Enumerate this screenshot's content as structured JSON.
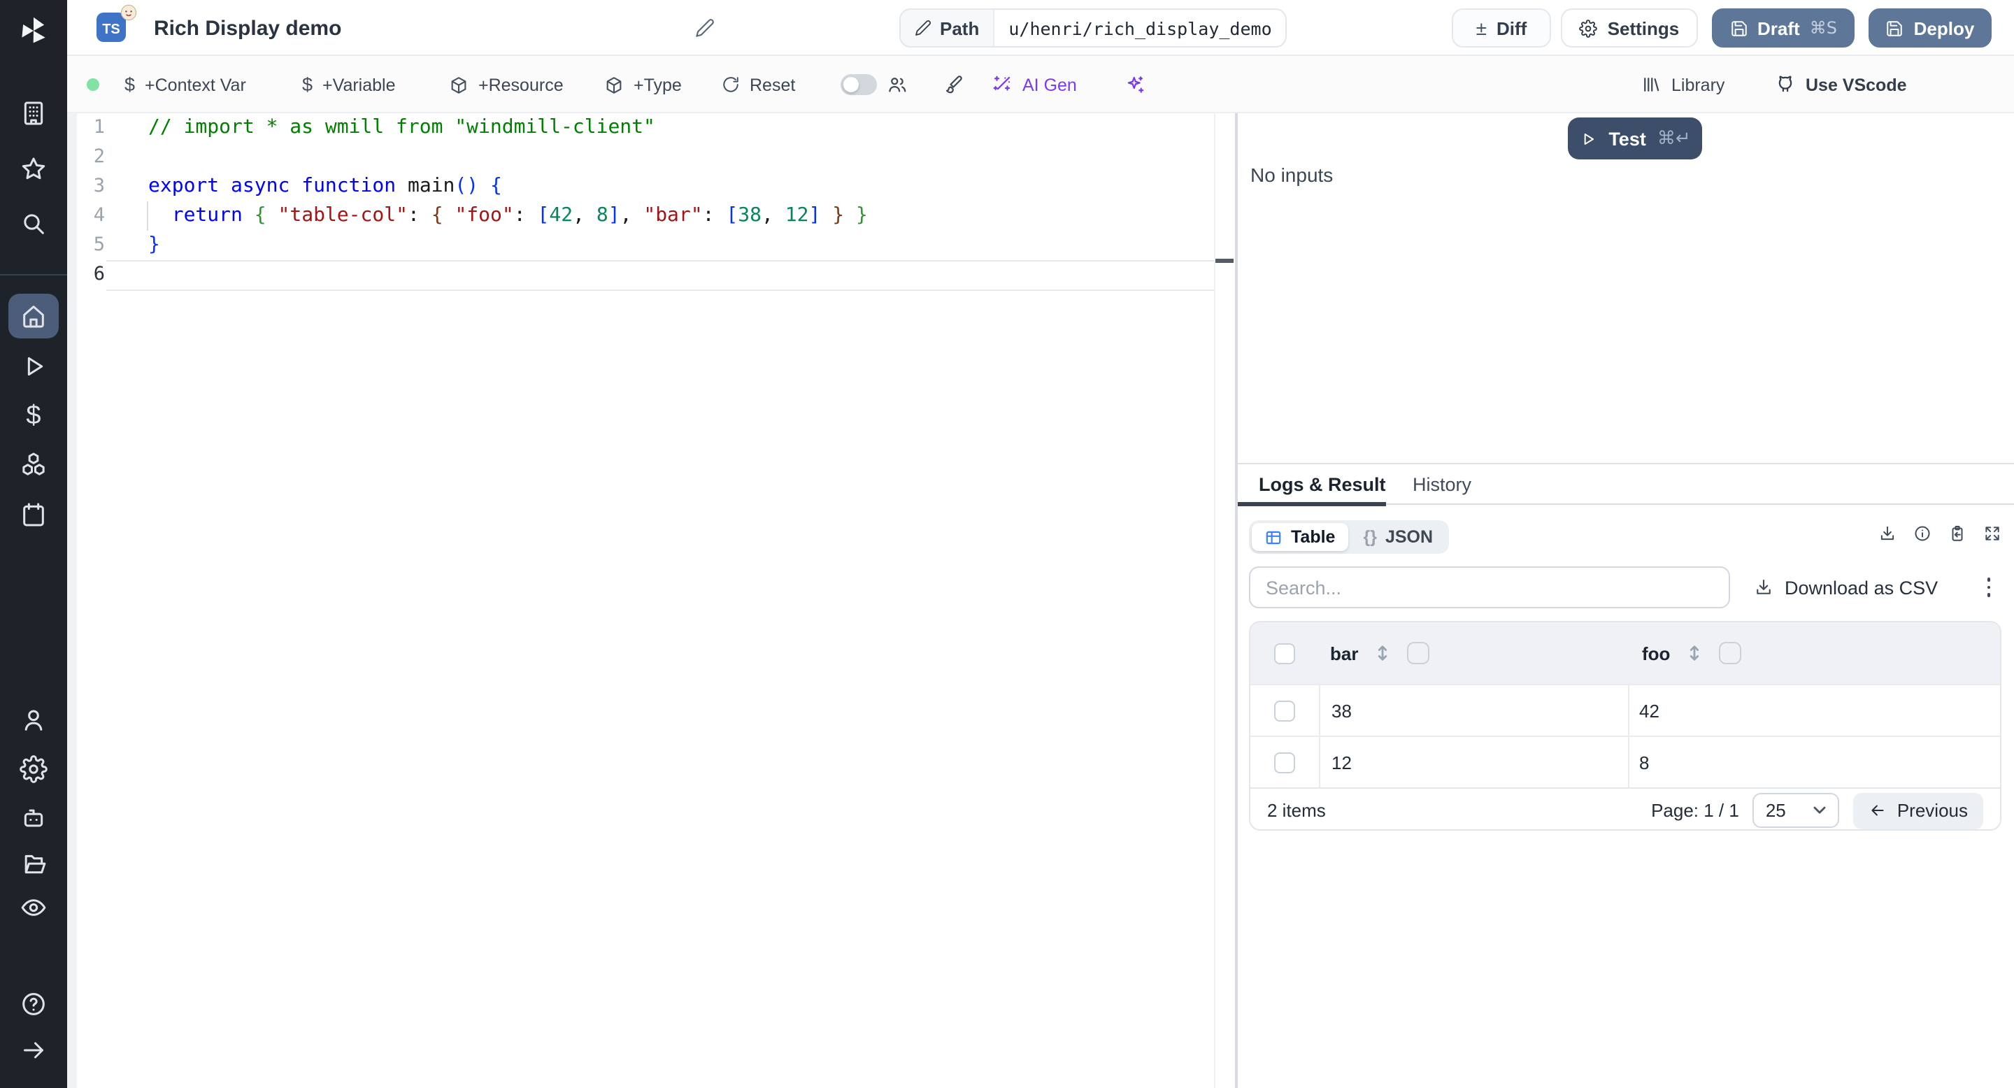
{
  "colors": {
    "accent-button": "#5e7798",
    "test-button": "#3d4e6b",
    "ai-purple": "#7c3aed",
    "ts-blue": "#3f73c6",
    "table-icon-blue": "#3b82f6",
    "status-green": "#80e3a3",
    "sidebar-bg": "#1e232a",
    "sidebar-active": "#4b5d79"
  },
  "topbar": {
    "language_badge": "TS",
    "title": "Rich Display demo",
    "path_label": "Path",
    "path_value": "u/henri/rich_display_demo",
    "diff_label": "Diff",
    "diff_icon": "±",
    "settings_label": "Settings",
    "draft_label": "Draft",
    "draft_shortcut": "⌘S",
    "deploy_label": "Deploy"
  },
  "toolbar": {
    "dollar_icon": "$",
    "context_var_label": "+Context Var",
    "variable_label": "+Variable",
    "resource_label": "+Resource",
    "type_label": "+Type",
    "reset_label": "Reset",
    "ai_gen_label": "AI Gen",
    "library_label": "Library",
    "vscode_label": "Use VScode"
  },
  "editor": {
    "lines": [
      {
        "number": "1",
        "tokens": [
          [
            "// import * as wmill from \"windmill-client\"",
            "comment"
          ]
        ]
      },
      {
        "number": "2",
        "tokens": []
      },
      {
        "number": "3",
        "tokens": [
          [
            "export",
            "keyword"
          ],
          [
            " ",
            "plain"
          ],
          [
            "async",
            "keyword"
          ],
          [
            " ",
            "plain"
          ],
          [
            "function",
            "keyword"
          ],
          [
            " ",
            "plain"
          ],
          [
            "main",
            "plain"
          ],
          [
            "()",
            "b1"
          ],
          [
            " ",
            "plain"
          ],
          [
            "{",
            "b1"
          ]
        ]
      },
      {
        "number": "4",
        "tokens": [
          [
            "  ",
            "plain"
          ],
          [
            "return",
            "keyword"
          ],
          [
            " ",
            "plain"
          ],
          [
            "{",
            "b2"
          ],
          [
            " ",
            "plain"
          ],
          [
            "\"table-col\"",
            "string"
          ],
          [
            ":",
            "plain"
          ],
          [
            " ",
            "plain"
          ],
          [
            "{",
            "b3"
          ],
          [
            " ",
            "plain"
          ],
          [
            "\"foo\"",
            "string"
          ],
          [
            ":",
            "plain"
          ],
          [
            " ",
            "plain"
          ],
          [
            "[",
            "b1"
          ],
          [
            "42",
            "number"
          ],
          [
            ",",
            "plain"
          ],
          [
            " ",
            "plain"
          ],
          [
            "8",
            "number"
          ],
          [
            "]",
            "b1"
          ],
          [
            ",",
            "plain"
          ],
          [
            " ",
            "plain"
          ],
          [
            "\"bar\"",
            "string"
          ],
          [
            ":",
            "plain"
          ],
          [
            " ",
            "plain"
          ],
          [
            "[",
            "b1"
          ],
          [
            "38",
            "number"
          ],
          [
            ",",
            "plain"
          ],
          [
            " ",
            "plain"
          ],
          [
            "12",
            "number"
          ],
          [
            "]",
            "b1"
          ],
          [
            " ",
            "plain"
          ],
          [
            "}",
            "b3"
          ],
          [
            " ",
            "plain"
          ],
          [
            "}",
            "b2"
          ]
        ]
      },
      {
        "number": "5",
        "tokens": [
          [
            "}",
            "b1"
          ]
        ]
      },
      {
        "number": "6",
        "tokens": [],
        "current": true
      }
    ]
  },
  "runner": {
    "test_label": "Test",
    "test_shortcut": "⌘↵",
    "no_inputs_label": "No inputs"
  },
  "result_panel": {
    "tabs": {
      "logs": "Logs & Result",
      "history": "History"
    },
    "view_toggle": {
      "table": "Table",
      "json": "JSON",
      "json_icon": "{}"
    },
    "search_placeholder": "Search...",
    "download_csv_label": "Download as CSV",
    "table": {
      "columns": [
        "bar",
        "foo"
      ],
      "rows": [
        {
          "bar": "38",
          "foo": "42"
        },
        {
          "bar": "12",
          "foo": "8"
        }
      ],
      "footer": {
        "count": "2 items",
        "page": "Page: 1 / 1",
        "page_size": "25",
        "previous_label": "Previous"
      }
    }
  }
}
